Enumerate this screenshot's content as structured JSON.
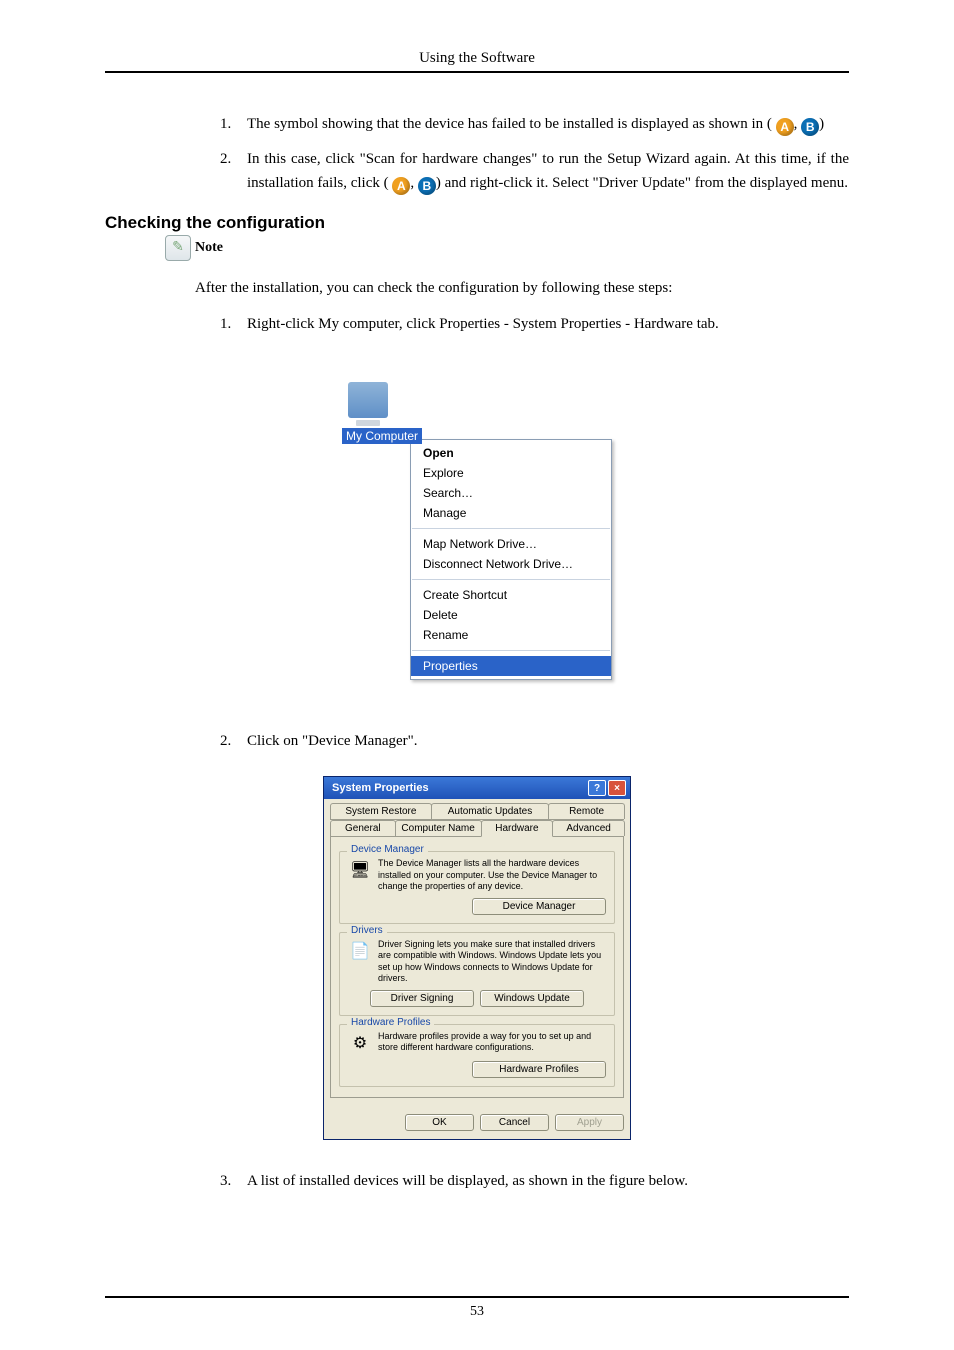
{
  "header": {
    "title": "Using the Software"
  },
  "badges": {
    "a": "A",
    "b": "B"
  },
  "topList": {
    "item1_part1": "The symbol showing that the device has failed to be installed is displayed as shown in (",
    "item1_part2": ", ",
    "item1_part3": ")",
    "item2_part1": "In this case, click \"Scan for hardware changes\" to run the Setup Wizard again. At this time, if the installation fails, click (",
    "item2_part2": ", ",
    "item2_part3": ") and right-click it. Select \"Driver Update\" from the displayed menu."
  },
  "section": {
    "heading": "Checking the configuration",
    "note": "Note",
    "intro": "After the installation, you can check the configuration by following these steps:",
    "step1": "Right-click My computer, click Properties - System Properties - Hardware tab.",
    "step2": "Click on \"Device Manager\".",
    "step3": "A list of installed devices will be displayed, as shown in the figure below."
  },
  "contextMenu": {
    "iconLabel": "My Computer",
    "items": {
      "open": "Open",
      "explore": "Explore",
      "search": "Search…",
      "manage": "Manage",
      "map": "Map Network Drive…",
      "disconnect": "Disconnect Network Drive…",
      "shortcut": "Create Shortcut",
      "delete": "Delete",
      "rename": "Rename",
      "properties": "Properties"
    }
  },
  "dialog": {
    "title": "System Properties",
    "tabs": {
      "systemRestore": "System Restore",
      "automaticUpdates": "Automatic Updates",
      "remote": "Remote",
      "general": "General",
      "computerName": "Computer Name",
      "hardware": "Hardware",
      "advanced": "Advanced"
    },
    "deviceManager": {
      "label": "Device Manager",
      "desc": "The Device Manager lists all the hardware devices installed on your computer. Use the Device Manager to change the properties of any device.",
      "button": "Device Manager"
    },
    "drivers": {
      "label": "Drivers",
      "desc": "Driver Signing lets you make sure that installed drivers are compatible with Windows. Windows Update lets you set up how Windows connects to Windows Update for drivers.",
      "signingBtn": "Driver Signing",
      "updateBtn": "Windows Update"
    },
    "hardwareProfiles": {
      "label": "Hardware Profiles",
      "desc": "Hardware profiles provide a way for you to set up and store different hardware configurations.",
      "button": "Hardware Profiles"
    },
    "footer": {
      "ok": "OK",
      "cancel": "Cancel",
      "apply": "Apply"
    }
  },
  "pageNumber": "53"
}
